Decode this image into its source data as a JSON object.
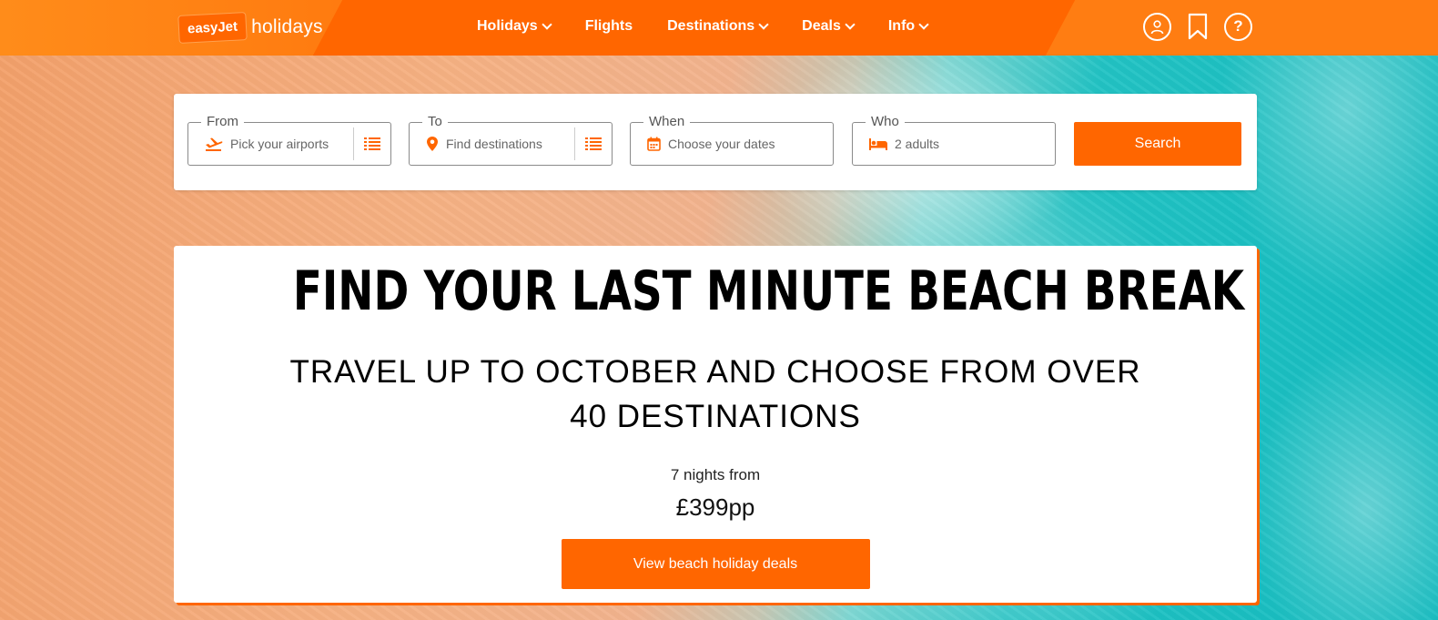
{
  "brand": {
    "logo_box": "easyJet",
    "logo_word": "holidays",
    "accent_color": "#ff6600"
  },
  "nav": {
    "items": [
      {
        "label": "Holidays",
        "has_dropdown": true
      },
      {
        "label": "Flights",
        "has_dropdown": false
      },
      {
        "label": "Destinations",
        "has_dropdown": true
      },
      {
        "label": "Deals",
        "has_dropdown": true
      },
      {
        "label": "Info",
        "has_dropdown": true
      }
    ],
    "icons": [
      "account-icon",
      "bookmark-icon",
      "help-icon"
    ],
    "help_glyph": "?"
  },
  "search": {
    "from": {
      "label": "From",
      "placeholder": "Pick your airports",
      "icon": "plane-takeoff-icon"
    },
    "to": {
      "label": "To",
      "placeholder": "Find destinations",
      "icon": "map-pin-icon"
    },
    "when": {
      "label": "When",
      "placeholder": "Choose your dates",
      "icon": "calendar-icon"
    },
    "who": {
      "label": "Who",
      "value": "2 adults",
      "icon": "bed-icon"
    },
    "button_label": "Search"
  },
  "hero": {
    "title": "FIND YOUR LAST MINUTE BEACH BREAK",
    "subtitle": "TRAVEL UP TO OCTOBER AND CHOOSE FROM OVER 40 DESTINATIONS",
    "price_prefix": "7 nights from",
    "price": "£399pp",
    "cta_label": "View beach holiday deals"
  }
}
